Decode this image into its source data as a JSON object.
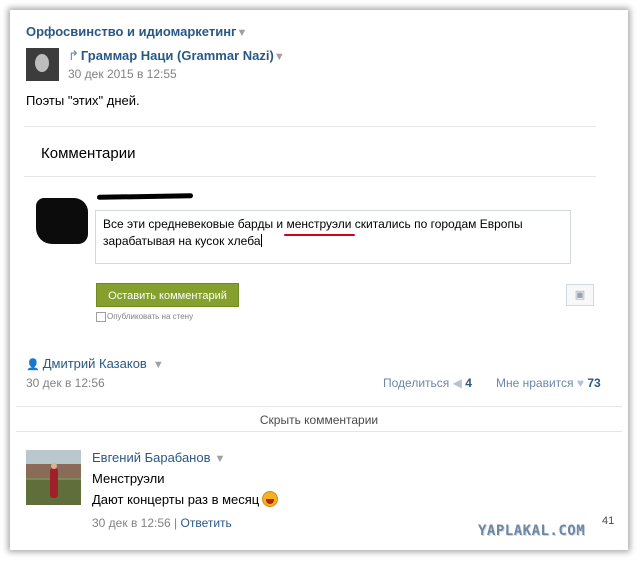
{
  "group": {
    "title": "Орфосвинство и идиомаркетинг",
    "arrow": "▼"
  },
  "repost": {
    "icon": "↱",
    "author": "Граммар Наци (Grammar Nazi)",
    "arrow": "▼",
    "date": "30 дек 2015 в 12:55"
  },
  "post": {
    "text": "Поэты \"этих\" дней."
  },
  "comments_header": "Комментарии",
  "draft": {
    "text_before": "Все эти средневековые барды и ",
    "underlined": "менструэли",
    "text_after": " скитались по городам Европы зарабатывая на кусок хлеба",
    "submit_label": "Оставить комментарий",
    "camera_icon": "camera-icon",
    "checkbox_label": "Опубликовать на стену"
  },
  "original_post": {
    "author": "Дмитрий Казаков",
    "arrow": "▼",
    "date": "30 дек в 12:56",
    "share_label": "Поделиться",
    "share_count": "4",
    "like_label": "Мне нравится",
    "like_count": "73"
  },
  "hide_comments": "Скрыть комментарии",
  "comment": {
    "author": "Евгений Барабанов",
    "arrow": "▼",
    "line1": "Менструэли",
    "line2": "Дают концерты раз в месяц",
    "date": "30 дек в 12:56",
    "separator": "|",
    "reply": "Ответить",
    "count": "41"
  },
  "watermark": "YAPLAKAL.COM",
  "colors": {
    "link": "#2a5885",
    "button": "#86a02e",
    "underline": "#d0021b"
  }
}
